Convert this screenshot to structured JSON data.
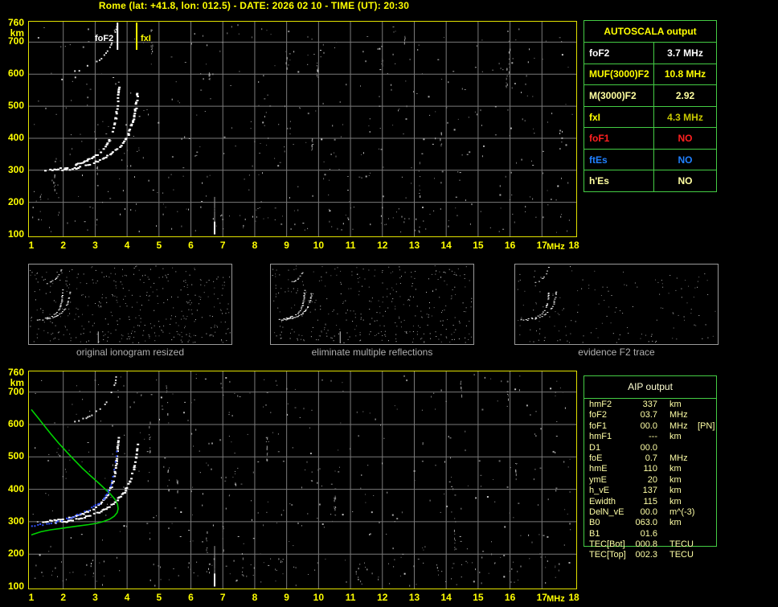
{
  "title": "Rome (lat: +41.8, lon: 012.5) - DATE: 2026 02 10 - TIME (UT): 20:30",
  "colors": {
    "background": "#000000",
    "accent_yellow": "#ffff00",
    "plot_border": "#e2e200",
    "grid": "#7a7a7a",
    "table_border_green": "#44cc44",
    "trace_white": "#ffffff",
    "profile_green": "#00d400",
    "fitted_blue": "#3352ff",
    "khaki": "#ffffa0",
    "dim_yellow": "#c8c800",
    "red": "#ff2020",
    "blue": "#2080ff",
    "caption_gray": "#b0b0b0"
  },
  "autoscala": {
    "title": "AUTOSCALA output",
    "rows": [
      {
        "label": "foF2",
        "value": "3.7 MHz",
        "color": "#ffffff",
        "value_color": "#ffffff"
      },
      {
        "label": "MUF(3000)F2",
        "value": "10.8 MHz",
        "color": "#ffff00",
        "value_color": "#ffff00"
      },
      {
        "label": "M(3000)F2",
        "value": "2.92",
        "color": "#ffffa0",
        "value_color": "#ffffa0"
      },
      {
        "label": "fxI",
        "value": "4.3 MHz",
        "color": "#ffff00",
        "value_color": "#c8c800"
      },
      {
        "label": "foF1",
        "value": "NO",
        "color": "#ff2020",
        "value_color": "#ff2020"
      },
      {
        "label": "ftEs",
        "value": "NO",
        "color": "#2080ff",
        "value_color": "#2080ff"
      },
      {
        "label": "h'Es",
        "value": "NO",
        "color": "#ffffa0",
        "value_color": "#ffffa0"
      }
    ]
  },
  "aip": {
    "title": "AIP output",
    "rows": [
      {
        "param": "hmF2",
        "value": "337",
        "unit": "km",
        "note": ""
      },
      {
        "param": "foF2",
        "value": "03.7",
        "unit": "MHz",
        "note": ""
      },
      {
        "param": "foF1",
        "value": "00.0",
        "unit": "MHz",
        "note": "[PN]"
      },
      {
        "param": "hmF1",
        "value": "---",
        "unit": "km",
        "note": ""
      },
      {
        "param": "D1",
        "value": "00.0",
        "unit": "",
        "note": ""
      },
      {
        "param": "foE",
        "value": "0.7",
        "unit": "MHz",
        "note": ""
      },
      {
        "param": "hmE",
        "value": "110",
        "unit": "km",
        "note": ""
      },
      {
        "param": "ymE",
        "value": "20",
        "unit": "km",
        "note": ""
      },
      {
        "param": "h_vE",
        "value": "137",
        "unit": "km",
        "note": ""
      },
      {
        "param": "Ewidth",
        "value": "115",
        "unit": "km",
        "note": ""
      },
      {
        "param": "DelN_vE",
        "value": "00.0",
        "unit": "m^(-3)",
        "note": ""
      },
      {
        "param": "B0",
        "value": "063.0",
        "unit": "km",
        "note": ""
      },
      {
        "param": "B1",
        "value": "01.6",
        "unit": "",
        "note": ""
      },
      {
        "param": "TEC[Bot]",
        "value": "000.8",
        "unit": "TECU",
        "note": ""
      },
      {
        "param": "TEC[Top]",
        "value": "002.3",
        "unit": "TECU",
        "note": ""
      }
    ]
  },
  "thumbnails": {
    "captions": [
      "original ionogram resized",
      "eliminate multiple reflections",
      "evidence F2 trace"
    ]
  },
  "chart_data": [
    {
      "id": "ionogram-top",
      "type": "scatter",
      "title": "ionogram with AUTOSCALA scaled characteristics",
      "xlabel": "MHz",
      "ylabel": "km",
      "xlim": [
        1,
        18
      ],
      "ylim": [
        100,
        760
      ],
      "xticks": [
        1,
        2,
        3,
        4,
        5,
        6,
        7,
        8,
        9,
        10,
        11,
        12,
        13,
        14,
        15,
        16,
        17,
        18
      ],
      "yticks": [
        760,
        700,
        600,
        500,
        400,
        300,
        200,
        100
      ],
      "grid": true,
      "legend_position": "none",
      "markers": [
        {
          "name": "foF2",
          "label": "foF2",
          "freq_mhz": 3.7,
          "color": "#ffffff"
        },
        {
          "name": "fxI",
          "label": "fxI",
          "freq_mhz": 4.3,
          "color": "#ffff00"
        }
      ],
      "series": [
        {
          "name": "F2-layer O-mode trace",
          "type": "dots",
          "color": "#ffffff",
          "points": [
            [
              1.35,
              302
            ],
            [
              1.55,
              304
            ],
            [
              1.75,
              306
            ],
            [
              1.95,
              309
            ],
            [
              2.15,
              313
            ],
            [
              2.35,
              318
            ],
            [
              2.55,
              325
            ],
            [
              2.75,
              334
            ],
            [
              2.95,
              345
            ],
            [
              3.1,
              356
            ],
            [
              3.22,
              368
            ],
            [
              3.33,
              382
            ],
            [
              3.42,
              398
            ],
            [
              3.5,
              417
            ],
            [
              3.56,
              438
            ],
            [
              3.61,
              462
            ],
            [
              3.64,
              487
            ],
            [
              3.66,
              510
            ],
            [
              3.68,
              532
            ],
            [
              3.7,
              552
            ],
            [
              3.71,
              568
            ]
          ]
        },
        {
          "name": "F2-layer X-mode trace",
          "type": "dots",
          "color": "#ffffff",
          "points": [
            [
              1.75,
              300
            ],
            [
              2.0,
              303
            ],
            [
              2.25,
              307
            ],
            [
              2.5,
              312
            ],
            [
              2.75,
              319
            ],
            [
              3.0,
              328
            ],
            [
              3.2,
              337
            ],
            [
              3.4,
              349
            ],
            [
              3.58,
              362
            ],
            [
              3.74,
              377
            ],
            [
              3.88,
              394
            ],
            [
              4.0,
              413
            ],
            [
              4.09,
              434
            ],
            [
              4.16,
              457
            ],
            [
              4.21,
              480
            ],
            [
              4.25,
              503
            ],
            [
              4.28,
              525
            ],
            [
              4.3,
              548
            ]
          ]
        },
        {
          "name": "second-hop F2 echo",
          "type": "dots",
          "color": "#dddddd",
          "points": [
            [
              2.35,
              612
            ],
            [
              2.55,
              618
            ],
            [
              2.75,
              626
            ],
            [
              2.95,
              636
            ],
            [
              3.12,
              649
            ],
            [
              3.27,
              664
            ],
            [
              3.4,
              682
            ],
            [
              3.5,
              702
            ],
            [
              3.58,
              724
            ],
            [
              3.64,
              748
            ],
            [
              3.67,
              758
            ]
          ]
        },
        {
          "name": "vertical interference line",
          "type": "vline",
          "color": "#ffffff",
          "freq_mhz": 6.73,
          "km_range": [
            100,
            225
          ]
        }
      ]
    },
    {
      "id": "ionogram-bottom",
      "type": "scatter",
      "title": "adjusted ionogram with restored trace and electron density profile",
      "xlabel": "MHz",
      "ylabel": "km",
      "xlim": [
        1,
        18
      ],
      "ylim": [
        100,
        760
      ],
      "xticks": [
        1,
        2,
        3,
        4,
        5,
        6,
        7,
        8,
        9,
        10,
        11,
        12,
        13,
        14,
        15,
        16,
        17,
        18
      ],
      "yticks": [
        760,
        700,
        600,
        500,
        400,
        300,
        200,
        100
      ],
      "grid": true,
      "legend_position": "none",
      "markers": [],
      "series": [
        {
          "name": "electron density profile N(h)",
          "type": "line",
          "color": "#00d400",
          "points": [
            [
              1.0,
              646
            ],
            [
              1.2,
              622
            ],
            [
              1.4,
              597
            ],
            [
              1.62,
              570
            ],
            [
              1.85,
              543
            ],
            [
              2.1,
              516
            ],
            [
              2.35,
              490
            ],
            [
              2.6,
              465
            ],
            [
              2.85,
              442
            ],
            [
              3.1,
              420
            ],
            [
              3.3,
              402
            ],
            [
              3.48,
              385
            ],
            [
              3.62,
              369
            ],
            [
              3.7,
              354
            ],
            [
              3.72,
              340
            ],
            [
              3.69,
              328
            ],
            [
              3.6,
              317
            ],
            [
              3.46,
              308
            ],
            [
              3.27,
              301
            ],
            [
              3.05,
              295
            ],
            [
              2.8,
              291
            ],
            [
              2.5,
              287
            ],
            [
              2.2,
              283
            ],
            [
              1.9,
              279
            ],
            [
              1.6,
              275
            ],
            [
              1.3,
              269
            ],
            [
              1.05,
              261
            ],
            [
              1.0,
              259
            ]
          ]
        },
        {
          "name": "F2-layer O-mode trace",
          "type": "dots",
          "color": "#ffffff",
          "points": [
            [
              1.35,
              302
            ],
            [
              1.55,
              304
            ],
            [
              1.75,
              306
            ],
            [
              1.95,
              309
            ],
            [
              2.15,
              313
            ],
            [
              2.35,
              318
            ],
            [
              2.55,
              325
            ],
            [
              2.75,
              334
            ],
            [
              2.95,
              345
            ],
            [
              3.1,
              356
            ],
            [
              3.22,
              368
            ],
            [
              3.33,
              382
            ],
            [
              3.42,
              398
            ],
            [
              3.5,
              417
            ],
            [
              3.56,
              438
            ],
            [
              3.61,
              462
            ],
            [
              3.64,
              487
            ],
            [
              3.66,
              510
            ],
            [
              3.68,
              532
            ],
            [
              3.7,
              552
            ],
            [
              3.71,
              568
            ]
          ]
        },
        {
          "name": "F2-layer X-mode trace",
          "type": "dots",
          "color": "#ffffff",
          "points": [
            [
              1.75,
              300
            ],
            [
              2.0,
              303
            ],
            [
              2.25,
              307
            ],
            [
              2.5,
              312
            ],
            [
              2.75,
              319
            ],
            [
              3.0,
              328
            ],
            [
              3.2,
              337
            ],
            [
              3.4,
              349
            ],
            [
              3.58,
              362
            ],
            [
              3.74,
              377
            ],
            [
              3.88,
              394
            ],
            [
              4.0,
              413
            ],
            [
              4.09,
              434
            ],
            [
              4.16,
              457
            ],
            [
              4.21,
              480
            ],
            [
              4.25,
              503
            ],
            [
              4.28,
              525
            ],
            [
              4.3,
              548
            ]
          ]
        },
        {
          "name": "second-hop F2 echo",
          "type": "dots",
          "color": "#dddddd",
          "points": [
            [
              2.35,
              612
            ],
            [
              2.55,
              618
            ],
            [
              2.75,
              626
            ],
            [
              2.95,
              636
            ],
            [
              3.12,
              649
            ],
            [
              3.27,
              664
            ],
            [
              3.4,
              682
            ],
            [
              3.5,
              702
            ],
            [
              3.58,
              724
            ],
            [
              3.64,
              748
            ],
            [
              3.67,
              758
            ]
          ]
        },
        {
          "name": "restored O-mode trace fit",
          "type": "dots",
          "color": "#3352ff",
          "points": [
            [
              1.0,
              289
            ],
            [
              1.2,
              292
            ],
            [
              1.4,
              296
            ],
            [
              1.6,
              300
            ],
            [
              1.8,
              304
            ],
            [
              2.0,
              309
            ],
            [
              2.2,
              315
            ],
            [
              2.4,
              322
            ],
            [
              2.6,
              330
            ],
            [
              2.8,
              340
            ],
            [
              3.0,
              352
            ],
            [
              3.15,
              364
            ],
            [
              3.28,
              378
            ],
            [
              3.38,
              394
            ],
            [
              3.46,
              412
            ],
            [
              3.53,
              433
            ],
            [
              3.58,
              456
            ],
            [
              3.62,
              480
            ],
            [
              3.65,
              504
            ],
            [
              3.67,
              524
            ]
          ]
        },
        {
          "name": "vertical interference line",
          "type": "vline",
          "color": "#ffffff",
          "freq_mhz": 6.73,
          "km_range": [
            100,
            225
          ]
        }
      ]
    }
  ]
}
